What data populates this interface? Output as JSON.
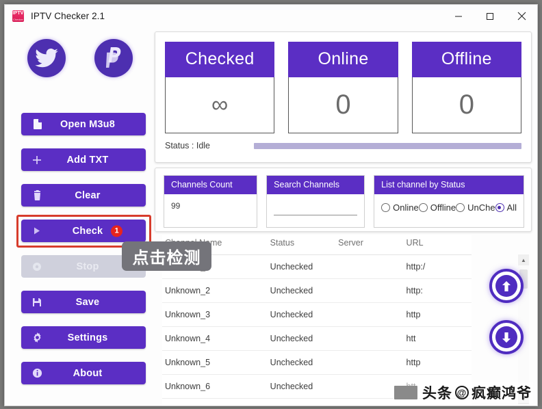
{
  "window": {
    "title": "IPTV Checker 2.1",
    "app_icon_line1": "IPTV",
    "app_icon_line2": "Checker",
    "minimize_label": "Minimize",
    "maximize_label": "Maximize",
    "close_label": "Close"
  },
  "sidebar": {
    "social": [
      {
        "name": "twitter-icon",
        "label": "Twitter"
      },
      {
        "name": "paypal-icon",
        "label": "PayPal"
      }
    ],
    "buttons": [
      {
        "label": "Open M3u8",
        "icon": "file-icon",
        "state": "enabled"
      },
      {
        "label": "Add TXT",
        "icon": "plus-icon",
        "state": "enabled"
      },
      {
        "label": "Clear",
        "icon": "trash-icon",
        "state": "enabled"
      },
      {
        "label": "Check",
        "icon": "play-icon",
        "state": "enabled",
        "badge": "1"
      },
      {
        "label": "Stop",
        "icon": "stop-icon",
        "state": "disabled"
      },
      {
        "label": "Save",
        "icon": "save-icon",
        "state": "enabled"
      },
      {
        "label": "Settings",
        "icon": "gear-icon",
        "state": "enabled"
      },
      {
        "label": "About",
        "icon": "info-icon",
        "state": "enabled"
      }
    ]
  },
  "callout": {
    "text": "点击检测"
  },
  "stats": {
    "cards": [
      {
        "title": "Checked",
        "value": "∞"
      },
      {
        "title": "Online",
        "value": "0"
      },
      {
        "title": "Offline",
        "value": "0"
      }
    ],
    "status_label": "Status : Idle",
    "progress_percent": 100
  },
  "filters": {
    "channels_count": {
      "title": "Channels Count",
      "value": "99"
    },
    "search": {
      "title": "Search Channels",
      "value": "",
      "placeholder": ""
    },
    "status_filter": {
      "title": "List channel by Status",
      "options": [
        {
          "label": "Online",
          "selected": false
        },
        {
          "label": "Offline",
          "selected": false
        },
        {
          "label": "UnChe",
          "selected": false
        },
        {
          "label": "All",
          "selected": true
        }
      ]
    }
  },
  "table": {
    "columns": [
      "Channel Name",
      "Status",
      "Server",
      "URL"
    ],
    "rows": [
      {
        "name": "Unknown_1",
        "status": "Unchecked",
        "server": "",
        "url": "http:/"
      },
      {
        "name": "Unknown_2",
        "status": "Unchecked",
        "server": "",
        "url": "http:"
      },
      {
        "name": "Unknown_3",
        "status": "Unchecked",
        "server": "",
        "url": "http"
      },
      {
        "name": "Unknown_4",
        "status": "Unchecked",
        "server": "",
        "url": "htt"
      },
      {
        "name": "Unknown_5",
        "status": "Unchecked",
        "server": "",
        "url": "http"
      },
      {
        "name": "Unknown_6",
        "status": "Unchecked",
        "server": "",
        "url": "htt"
      }
    ]
  },
  "side_actions": {
    "move_up": "Move Up",
    "move_down": "Move Down"
  },
  "watermark": {
    "text": "头条",
    "handle": "疯癫鸿爷",
    "at": "@"
  },
  "colors": {
    "purple": "#5b2ec4",
    "purple_dark": "#4d2fb0",
    "badge_red": "#e8241c",
    "highlight_red": "#d73c2c",
    "progress": "#b4aed6",
    "disabled": "#cfd0dc"
  }
}
